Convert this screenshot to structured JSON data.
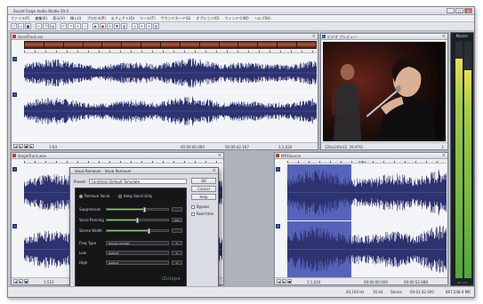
{
  "app": {
    "title": "Sound Forge Audio Studio 10.0",
    "window_buttons": [
      "_",
      "□",
      "×"
    ]
  },
  "menu": [
    "ファイル(F)",
    "編集(E)",
    "表示(V)",
    "挿入(I)",
    "プロセス(P)",
    "エフェクト(O)",
    "ツール(T)",
    "サウンドカード(S)",
    "オプション(O)",
    "ウィンドウ(W)",
    "ヘルプ(H)"
  ],
  "toolbar_icons": [
    "new-icon",
    "open-icon",
    "save-icon",
    "cut-icon",
    "copy-icon",
    "paste-icon",
    "undo-icon",
    "redo-icon",
    "zoom-in-icon",
    "zoom-out-icon",
    "play-icon",
    "record-icon",
    "loop-icon",
    "marker-icon",
    "region-icon",
    "burn-icon",
    "effect-icon",
    "mixer-icon",
    "meter-icon"
  ],
  "panels": {
    "top": {
      "title": "VocalTrack.avi",
      "time_left": "00:00:00.000",
      "time_mid": "00:00:42.167",
      "time_right": "1:1,024",
      "zoom": "1:64"
    },
    "video": {
      "title": "ビデオ プレビュー",
      "subtitle": "ﾀﾞﾌﾞﾙ",
      "size_label": "320x240x32, 29.970i",
      "frame": "1"
    },
    "left": {
      "title": "SingleTrack.wav",
      "time_left": "00:00:00.000",
      "time_mid": "00:00:19.021",
      "zoom": "1:512"
    },
    "right": {
      "title": "MP3Source",
      "label": "BASIC",
      "time_left": "00:00:00.000",
      "time_mid": "00:00:52.688",
      "zoom": "1:1,024"
    }
  },
  "dialog": {
    "title": "Vocal Remover - Vocal Remover",
    "preset_label": "Preset:",
    "preset_value": "(Untitled) Default Template",
    "buttons": {
      "ok": "OK",
      "cancel": "Cancel",
      "help": "Help"
    },
    "checks": {
      "bypass": "Bypass",
      "realtime": "Real-time"
    },
    "plugin": {
      "radio": [
        "Remove Vocal",
        "Keep Vocal Only"
      ],
      "params": [
        {
          "label": "Suppression",
          "value": 0.62
        },
        {
          "label": "Vocal Panning",
          "value": 0.5,
          "display": "Mid"
        },
        {
          "label": "Stereo Width",
          "value": 0.7
        }
      ],
      "selects": [
        {
          "label": "Freq Type",
          "value": "Female Vocalist"
        },
        {
          "label": "Low",
          "value": "Default"
        },
        {
          "label": "High",
          "value": "Default"
        }
      ],
      "logo": "iZotope"
    }
  },
  "meters": {
    "label": "Master",
    "scale": "-Inf.  -Inf.",
    "levels": [
      0.93,
      0.88
    ]
  },
  "statusbar": {
    "left": "44,100 Hz",
    "mid1": "16 bit",
    "mid2": "Stereo",
    "mid3": "00:01:42.600",
    "right": "867,548.9 MB"
  }
}
